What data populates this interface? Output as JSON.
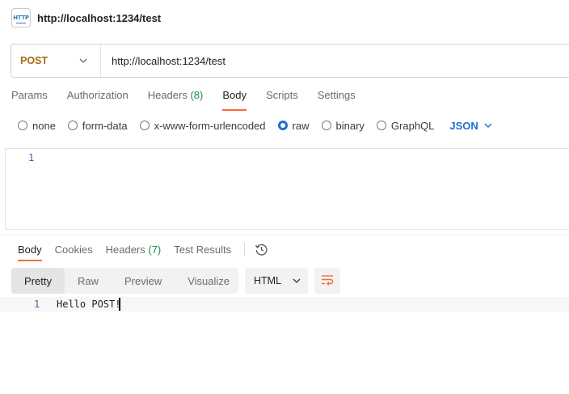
{
  "title": "http://localhost:1234/test",
  "tab_icon": {
    "name": "http-file-icon",
    "text": "HTTP"
  },
  "request": {
    "method": "POST",
    "url": "http://localhost:1234/test",
    "tabs": [
      {
        "label": "Params",
        "count": "",
        "active": false
      },
      {
        "label": "Authorization",
        "count": "",
        "active": false
      },
      {
        "label": "Headers",
        "count": "(8)",
        "active": false
      },
      {
        "label": "Body",
        "count": "",
        "active": true
      },
      {
        "label": "Scripts",
        "count": "",
        "active": false
      },
      {
        "label": "Settings",
        "count": "",
        "active": false
      }
    ],
    "body_types": [
      "none",
      "form-data",
      "x-www-form-urlencoded",
      "raw",
      "binary",
      "GraphQL"
    ],
    "body_type_selected": "raw",
    "format": "JSON",
    "editor_line": "1"
  },
  "response": {
    "tabs": [
      {
        "label": "Body",
        "count": "",
        "active": true
      },
      {
        "label": "Cookies",
        "count": "",
        "active": false
      },
      {
        "label": "Headers",
        "count": "(7)",
        "active": false
      },
      {
        "label": "Test Results",
        "count": "",
        "active": false
      }
    ],
    "views": [
      "Pretty",
      "Raw",
      "Preview",
      "Visualize"
    ],
    "view_selected": "Pretty",
    "language": "HTML",
    "line_number": "1",
    "body_text": "Hello POST!"
  },
  "colors": {
    "method": "#a86b0f",
    "accent": "#f26b3a",
    "link": "#1f6fd1",
    "count": "#1d8a4a"
  }
}
